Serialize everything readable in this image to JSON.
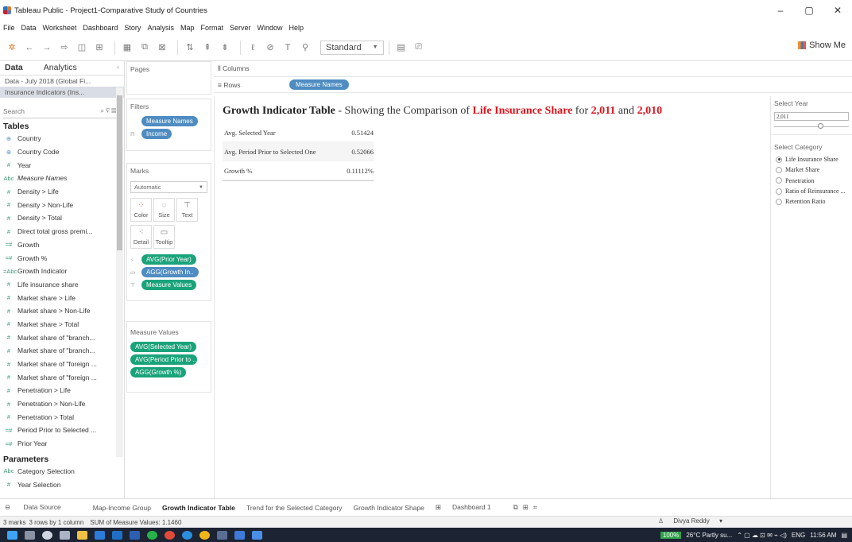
{
  "window": {
    "title": "Tableau Public - Project1-Comparative Study of Countries",
    "minimize": "–",
    "maximize": "▢",
    "close": "✕"
  },
  "menu": [
    "File",
    "Data",
    "Worksheet",
    "Dashboard",
    "Story",
    "Analysis",
    "Map",
    "Format",
    "Server",
    "Window",
    "Help"
  ],
  "toolbar": {
    "fit_dropdown": "Standard",
    "show_me": "Show Me"
  },
  "data_pane": {
    "tabs": {
      "data": "Data",
      "analytics": "Analytics"
    },
    "datasources": [
      "Data - July 2018 (Global Fi...",
      "Insurance Indicators (Ins..."
    ],
    "search_placeholder": "Search",
    "tables_heading": "Tables",
    "fields": [
      {
        "icon": "globe-icon",
        "glyph": "⊕",
        "label": "Country"
      },
      {
        "icon": "globe-icon",
        "glyph": "⊕",
        "label": "Country Code"
      },
      {
        "icon": "measure-icon",
        "glyph": "#",
        "label": "Year"
      },
      {
        "icon": "abc-icon",
        "glyph": "Abc",
        "label": "Measure Names"
      },
      {
        "icon": "measure-icon",
        "glyph": "#",
        "label": "Density > Life"
      },
      {
        "icon": "measure-icon",
        "glyph": "#",
        "label": "Density > Non-Life"
      },
      {
        "icon": "measure-icon",
        "glyph": "#",
        "label": "Density > Total"
      },
      {
        "icon": "measure-icon",
        "glyph": "#",
        "label": "Direct total gross premi..."
      },
      {
        "icon": "calc-icon",
        "glyph": "=#",
        "label": "Growth"
      },
      {
        "icon": "calc-icon",
        "glyph": "=#",
        "label": "Growth %"
      },
      {
        "icon": "abc-icon",
        "glyph": "=Abc",
        "label": "Growth Indicator"
      },
      {
        "icon": "measure-icon",
        "glyph": "#",
        "label": "Life insurance share"
      },
      {
        "icon": "measure-icon",
        "glyph": "#",
        "label": "Market share > Life"
      },
      {
        "icon": "measure-icon",
        "glyph": "#",
        "label": "Market share > Non-Life"
      },
      {
        "icon": "measure-icon",
        "glyph": "#",
        "label": "Market share > Total"
      },
      {
        "icon": "measure-icon",
        "glyph": "#",
        "label": "Market share of \"branch..."
      },
      {
        "icon": "measure-icon",
        "glyph": "#",
        "label": "Market share of \"branch..."
      },
      {
        "icon": "measure-icon",
        "glyph": "#",
        "label": "Market share of \"foreign ..."
      },
      {
        "icon": "measure-icon",
        "glyph": "#",
        "label": "Market share of \"foreign ..."
      },
      {
        "icon": "measure-icon",
        "glyph": "#",
        "label": "Penetration > Life"
      },
      {
        "icon": "measure-icon",
        "glyph": "#",
        "label": "Penetration > Non-Life"
      },
      {
        "icon": "measure-icon",
        "glyph": "#",
        "label": "Penetration > Total"
      },
      {
        "icon": "calc-icon",
        "glyph": "=#",
        "label": "Period Prior to Selected ..."
      },
      {
        "icon": "calc-icon",
        "glyph": "=#",
        "label": "Prior Year"
      }
    ],
    "parameters_heading": "Parameters",
    "parameters": [
      {
        "icon": "abc-icon",
        "glyph": "Abc",
        "label": "Category Selection"
      },
      {
        "icon": "measure-icon",
        "glyph": "#",
        "label": "Year Selection"
      }
    ]
  },
  "cards": {
    "pages": "Pages",
    "filters": {
      "title": "Filters",
      "pills": [
        "Measure Names",
        "Income"
      ]
    },
    "marks": {
      "title": "Marks",
      "type": "Automatic",
      "buttons": [
        "Color",
        "Size",
        "Text",
        "Detail",
        "Tooltip"
      ],
      "pills": [
        "AVG(Prior Year)",
        "AGG(Growth In..",
        "Measure Values"
      ]
    },
    "measure_values": {
      "title": "Measure Values",
      "pills": [
        "AVG(Selected Year)",
        "AVG(Period Prior to ..",
        "AGG(Growth %)"
      ]
    }
  },
  "shelves": {
    "columns": "Columns",
    "rows": "Rows",
    "rows_pill": "Measure Names"
  },
  "view": {
    "title_bold": "Growth Indicator Table",
    "title_dash": " - ",
    "title_text": "Showing the Comparison of ",
    "title_category": "Life Insurance Share",
    "title_for": " for ",
    "title_year1": "2,011",
    "title_and": " and ",
    "title_year2": "2,010",
    "rows": [
      {
        "label": "Avg. Selected Year",
        "value": "0.51424"
      },
      {
        "label": "Avg. Period Prior to Selected One",
        "value": "0.52066"
      },
      {
        "label": "Growth %",
        "value": "0.11112%"
      }
    ]
  },
  "right_pane": {
    "select_year": {
      "title": "Select Year",
      "value": "2,011"
    },
    "select_category": {
      "title": "Select Category",
      "options": [
        "Life Insurance Share",
        "Market Share",
        "Penetration",
        "Ratio of Reinsurance ...",
        "Retention Ratio"
      ],
      "selected": "Life Insurance Share"
    }
  },
  "sheet_tabs": [
    "Data Source",
    "Map-Income Group",
    "Growth Indicator Table",
    "Trend for the Selected Category",
    "Growth Indicator Shape",
    "Dashboard 1"
  ],
  "active_sheet": "Growth Indicator Table",
  "status": {
    "marks": "3 marks",
    "rows": "3 rows by 1 column",
    "sum": "SUM of Measure Values: 1.1460",
    "user": "Divya Reddy"
  },
  "taskbar": {
    "zoom": "100%",
    "weather": "26°C  Partly su...",
    "lang": "ENG",
    "time": "11:56 AM"
  },
  "colors": {
    "pill_green": "#1aa37a",
    "pill_blue": "#4e8cc2",
    "title_red": "#e0121b",
    "taskbar": "#1c2433"
  }
}
